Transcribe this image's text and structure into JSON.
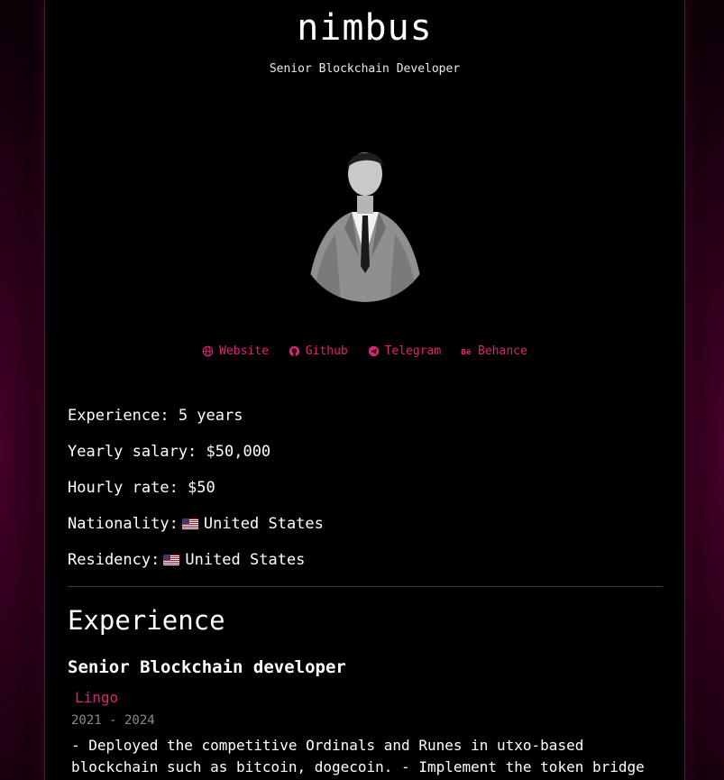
{
  "profile": {
    "name": "nimbus",
    "role": "Senior Blockchain Developer"
  },
  "links": [
    {
      "label": "Website",
      "icon": "globe-icon"
    },
    {
      "label": "Github",
      "icon": "github-icon"
    },
    {
      "label": "Telegram",
      "icon": "telegram-icon"
    },
    {
      "label": "Behance",
      "icon": "behance-icon"
    }
  ],
  "facts": {
    "experience": "Experience: 5 years",
    "yearly_salary": "Yearly salary: $50,000",
    "hourly_rate": "Hourly rate: $50",
    "nationality_label": "Nationality:",
    "nationality_value": "United States",
    "residency_label": "Residency:",
    "residency_value": "United States"
  },
  "experience_section": {
    "title": "Experience",
    "jobs": [
      {
        "title": "Senior Blockchain developer",
        "company": "Lingo",
        "dates": "2021 - 2024",
        "description": "- Deployed the competitive Ordinals and Runes in utxo-based blockchain such as bitcoin, dogecoin. - Implement the token bridge"
      }
    ]
  },
  "colors": {
    "accent": "#e0207a",
    "background": "#000000",
    "muted": "#8a8a8a"
  }
}
